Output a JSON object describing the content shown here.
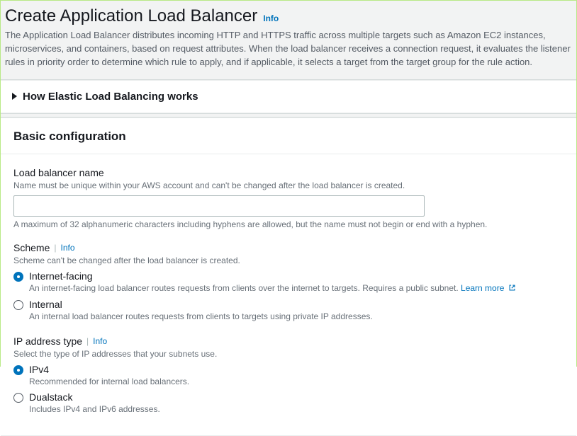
{
  "header": {
    "title": "Create Application Load Balancer",
    "info_label": "Info",
    "description": "The Application Load Balancer distributes incoming HTTP and HTTPS traffic across multiple targets such as Amazon EC2 instances, microservices, and containers, based on request attributes. When the load balancer receives a connection request, it evaluates the listener rules in priority order to determine which rule to apply, and if applicable, it selects a target from the target group for the rule action."
  },
  "expandable": {
    "title": "How Elastic Load Balancing works"
  },
  "basic_config": {
    "panel_title": "Basic configuration",
    "lb_name": {
      "label": "Load balancer name",
      "help": "Name must be unique within your AWS account and can't be changed after the load balancer is created.",
      "value": "",
      "constraint": "A maximum of 32 alphanumeric characters including hyphens are allowed, but the name must not begin or end with a hyphen."
    },
    "scheme": {
      "label": "Scheme",
      "info_label": "Info",
      "help": "Scheme can't be changed after the load balancer is created.",
      "options": [
        {
          "label": "Internet-facing",
          "description": "An internet-facing load balancer routes requests from clients over the internet to targets. Requires a public subnet.",
          "learn_more": "Learn more",
          "selected": true
        },
        {
          "label": "Internal",
          "description": "An internal load balancer routes requests from clients to targets using private IP addresses.",
          "selected": false
        }
      ]
    },
    "ip_type": {
      "label": "IP address type",
      "info_label": "Info",
      "help": "Select the type of IP addresses that your subnets use.",
      "options": [
        {
          "label": "IPv4",
          "description": "Recommended for internal load balancers.",
          "selected": true
        },
        {
          "label": "Dualstack",
          "description": "Includes IPv4 and IPv6 addresses.",
          "selected": false
        }
      ]
    }
  }
}
